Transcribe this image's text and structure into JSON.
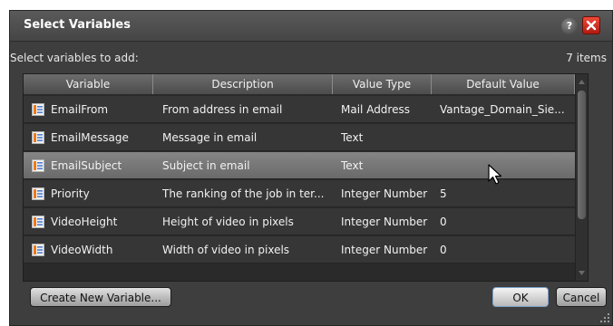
{
  "dialog": {
    "title": "Select Variables",
    "help_label": "?",
    "subheader": "Select variables to add:",
    "item_count": "7 items"
  },
  "table": {
    "columns": [
      "Variable",
      "Description",
      "Value Type",
      "Default Value"
    ],
    "rows": [
      {
        "variable": "EmailFrom",
        "description": "From address in email",
        "value_type": "Mail Address",
        "default_value": "Vantage_Domain_Sie..."
      },
      {
        "variable": "EmailMessage",
        "description": "Message in email",
        "value_type": "Text",
        "default_value": ""
      },
      {
        "variable": "EmailSubject",
        "description": "Subject in email",
        "value_type": "Text",
        "default_value": ""
      },
      {
        "variable": "Priority",
        "description": "The ranking of the job in ter...",
        "value_type": "Integer Number",
        "default_value": "5"
      },
      {
        "variable": "VideoHeight",
        "description": "Height of video in pixels",
        "value_type": "Integer Number",
        "default_value": "0"
      },
      {
        "variable": "VideoWidth",
        "description": "Width of video in pixels",
        "value_type": "Integer Number",
        "default_value": "0"
      }
    ],
    "selected_row": "EmailSubject",
    "row_icon": "variable-icon"
  },
  "buttons": {
    "create_new": "Create New Variable...",
    "ok": "OK",
    "cancel": "Cancel"
  },
  "colors": {
    "close_red": "#d8281a",
    "dialog_bg": "#3e3e3e",
    "selected_row": "#7a7a7a"
  }
}
